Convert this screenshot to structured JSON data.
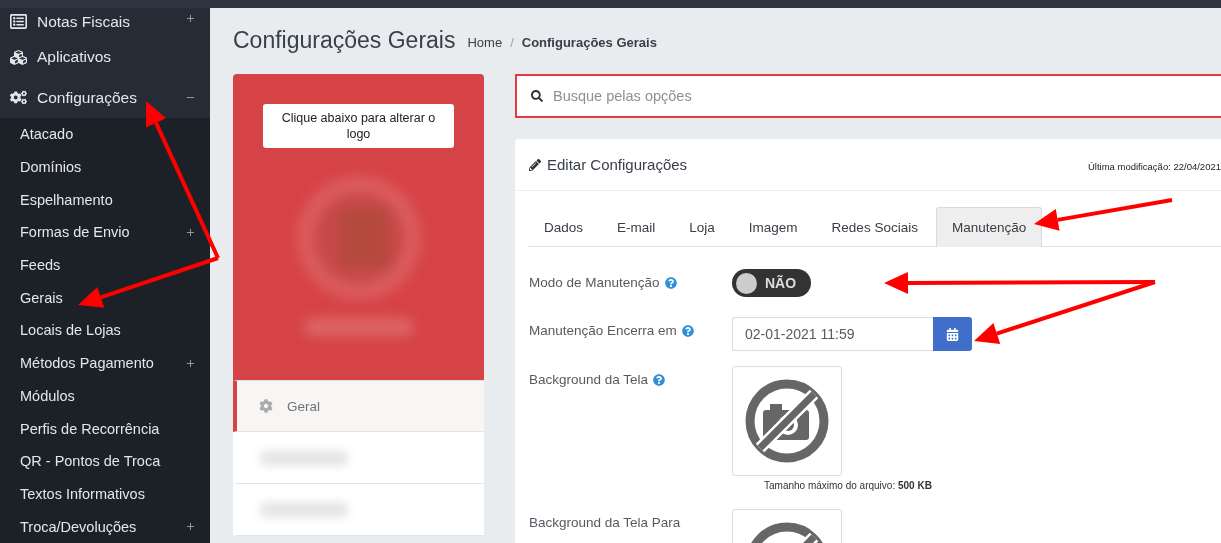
{
  "sidebar": {
    "items": [
      {
        "label": "Notas Fiscais",
        "expandable": true
      },
      {
        "label": "Aplicativos",
        "expandable": false
      },
      {
        "label": "Configurações",
        "expandable": true,
        "expanded": true,
        "children": [
          {
            "label": "Atacado",
            "expandable": false
          },
          {
            "label": "Domínios",
            "expandable": false
          },
          {
            "label": "Espelhamento",
            "expandable": false
          },
          {
            "label": "Formas de Envio",
            "expandable": true
          },
          {
            "label": "Feeds",
            "expandable": false
          },
          {
            "label": "Gerais",
            "expandable": false
          },
          {
            "label": "Locais de Lojas",
            "expandable": false
          },
          {
            "label": "Métodos Pagamento",
            "expandable": true
          },
          {
            "label": "Módulos",
            "expandable": false
          },
          {
            "label": "Perfis de Recorrência",
            "expandable": false
          },
          {
            "label": "QR - Pontos de Troca",
            "expandable": false
          },
          {
            "label": "Textos Informativos",
            "expandable": false
          },
          {
            "label": "Troca/Devoluções",
            "expandable": true
          }
        ]
      }
    ]
  },
  "page": {
    "title": "Configurações Gerais",
    "breadcrumb": [
      "Home",
      "Configurações Gerais"
    ],
    "breadcrumb_separator": "/"
  },
  "logo_card": {
    "button": "Clique abaixo para alterar o logo",
    "menu": [
      {
        "kind": "item",
        "label": "Geral",
        "selected": true
      },
      {
        "kind": "blurred",
        "selected": false
      },
      {
        "kind": "blurred",
        "selected": false
      }
    ]
  },
  "search": {
    "placeholder": "Busque pelas opções"
  },
  "settings_card": {
    "title": "Editar Configurações",
    "last_modified": "Última modificação: 22/04/2021",
    "tabs": [
      {
        "label": "Dados",
        "selected": false
      },
      {
        "label": "E-mail",
        "selected": false
      },
      {
        "label": "Loja",
        "selected": false
      },
      {
        "label": "Imagem",
        "selected": false
      },
      {
        "label": "Redes Sociais",
        "selected": false
      },
      {
        "label": "Manutenção",
        "selected": true
      }
    ],
    "fields": [
      {
        "kind": "toggle",
        "label": "Modo de Manutenção",
        "help": true,
        "on": false,
        "value": "NÃO"
      },
      {
        "kind": "date",
        "label": "Manutenção Encerra em",
        "help": true,
        "value": "02-01-2021 11:59"
      },
      {
        "label": "Background da Tela",
        "help": true,
        "caption": "Tamanho máximo do arquivo: **500 KB**"
      },
      {
        "label": "Background da Tela Para",
        "help": false
      }
    ]
  }
}
